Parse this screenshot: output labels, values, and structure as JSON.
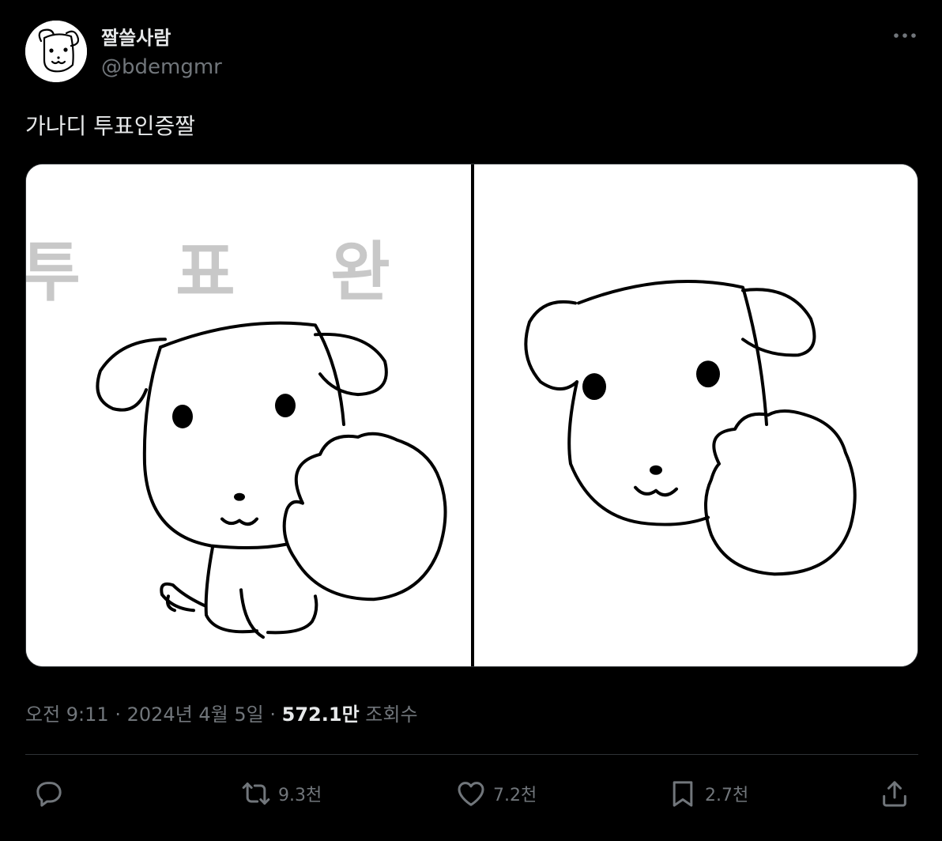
{
  "author": {
    "display_name": "짤쓸사람",
    "handle": "@bdemgmr"
  },
  "tweet": {
    "text": "가나디 투표인증짤",
    "media_text": "투 표 완"
  },
  "meta": {
    "time": "오전 9:11",
    "separator": "·",
    "date": "2024년 4월 5일",
    "views_count": "572.1만",
    "views_label": "조회수"
  },
  "actions": {
    "reply": {
      "icon": "reply-icon",
      "count": ""
    },
    "retweet": {
      "icon": "retweet-icon",
      "count": "9.3천"
    },
    "like": {
      "icon": "heart-icon",
      "count": "7.2천"
    },
    "bookmark": {
      "icon": "bookmark-icon",
      "count": "2.7천"
    },
    "share": {
      "icon": "share-icon",
      "count": ""
    }
  },
  "colors": {
    "background": "#000000",
    "text_primary": "#e7e9ea",
    "text_secondary": "#71767b",
    "border": "#2f3336",
    "stamp_text": "#c8c8c8"
  }
}
